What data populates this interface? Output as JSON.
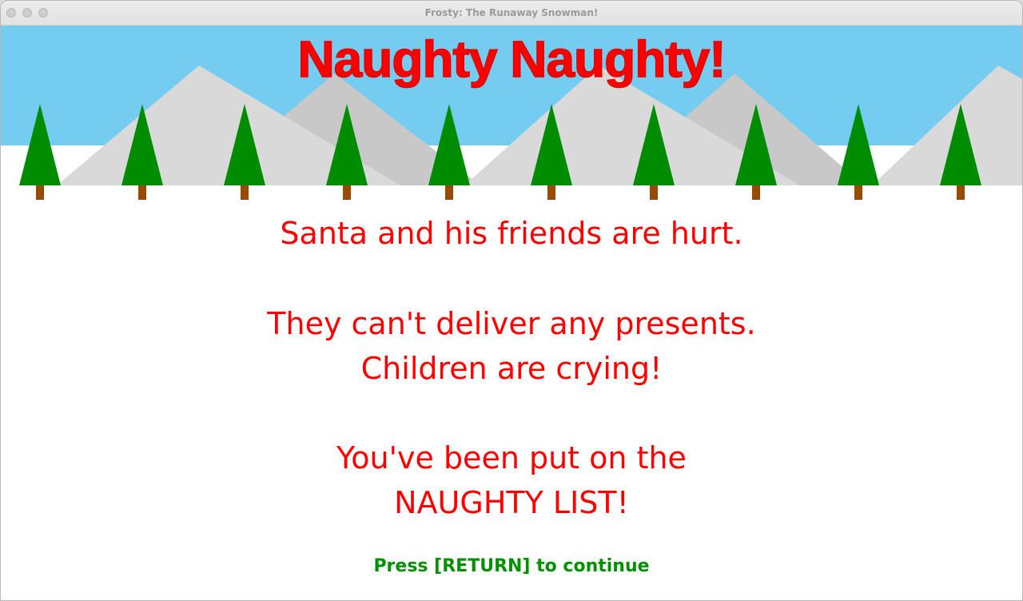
{
  "window": {
    "title": "Frosty: The Runaway Snowman!"
  },
  "screen": {
    "title": "Naughty Naughty!",
    "lines": [
      "Santa and his friends are hurt.",
      "They can't deliver any presents.",
      "Children are crying!",
      "You've been put on the",
      "NAUGHTY LIST!"
    ],
    "prompt": "Press [RETURN] to continue"
  },
  "colors": {
    "sky": "#74ccf0",
    "snow": "#ffffff",
    "mountain_light": "#d9d9d9",
    "mountain_dark": "#c8c8c8",
    "tree": "#008c00",
    "trunk": "#9a4a00",
    "title_text": "#ff0000",
    "message_text": "#ff0000",
    "prompt_text": "#009000"
  },
  "icons": {
    "close": "close-dot",
    "minimize": "minimize-dot",
    "zoom": "zoom-dot"
  }
}
